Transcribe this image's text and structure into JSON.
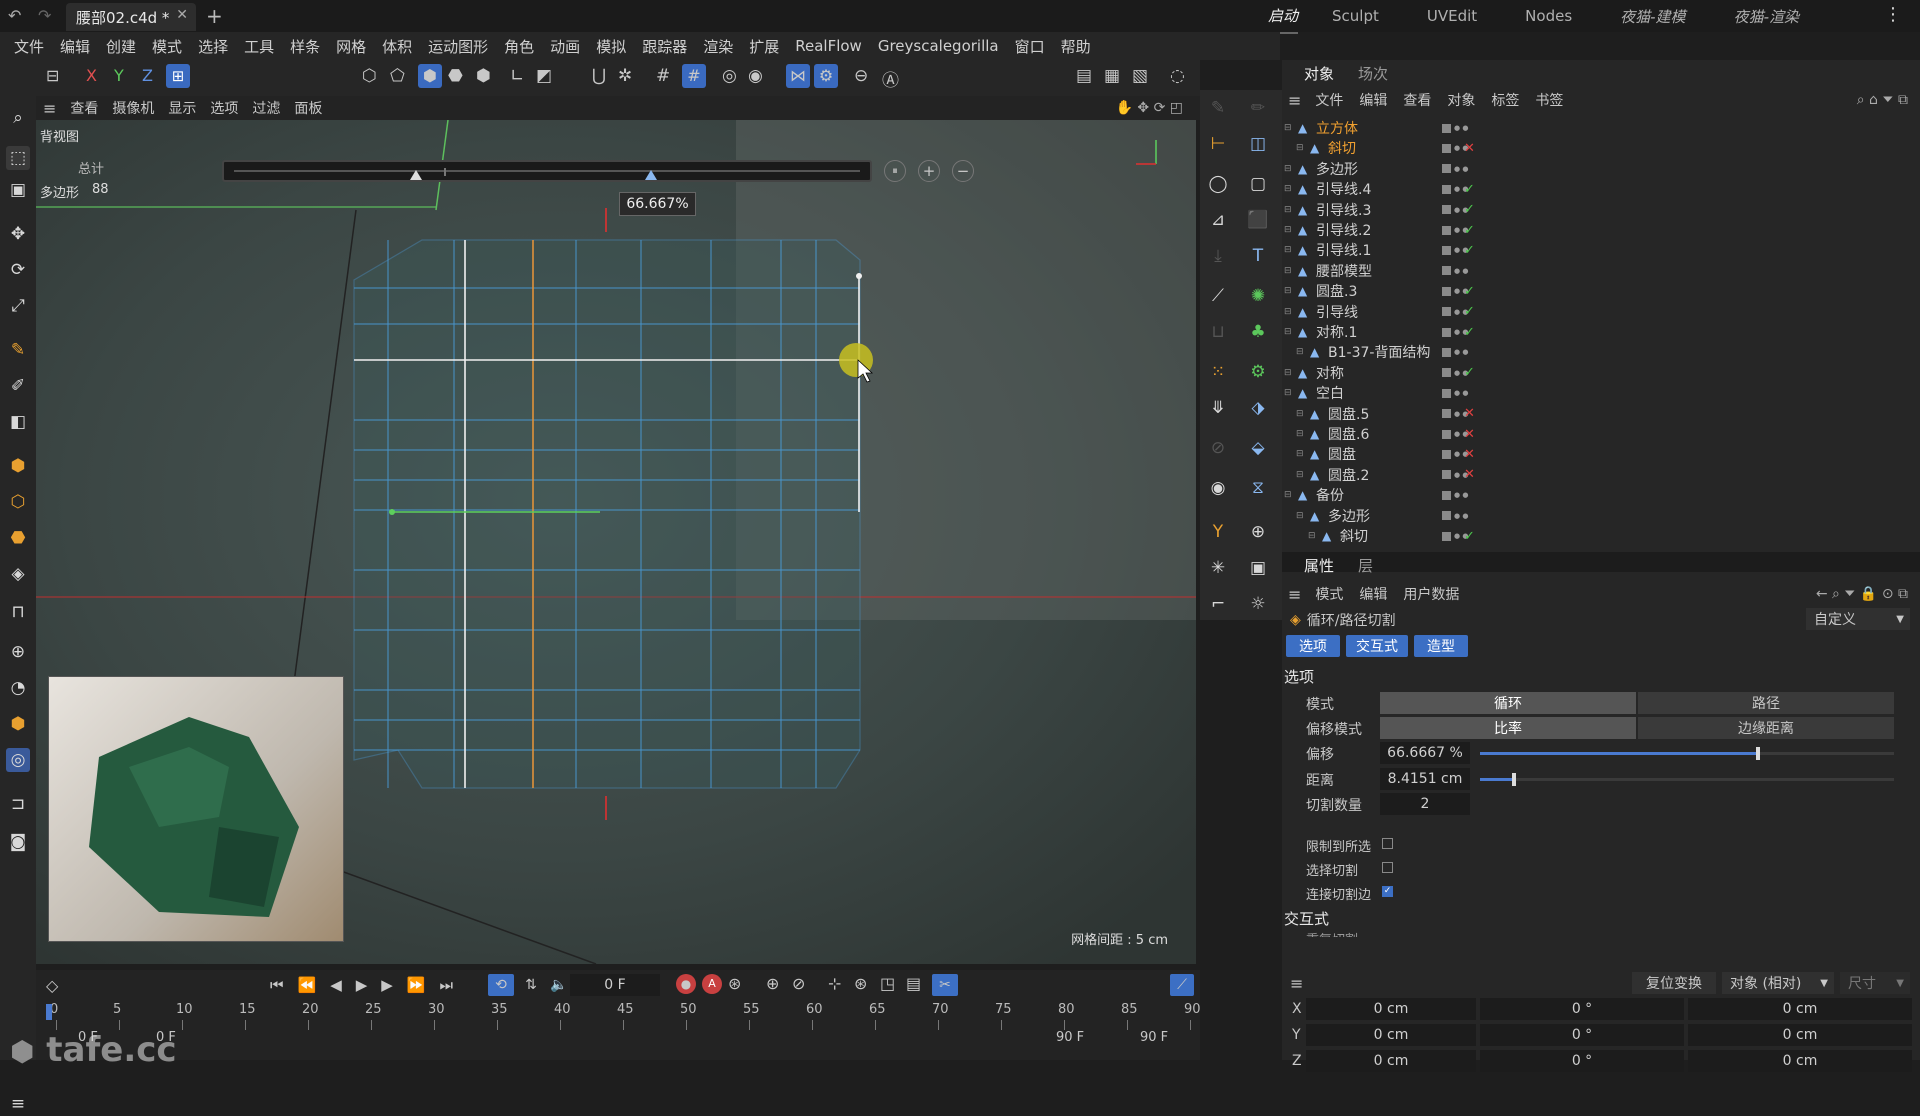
{
  "titlebar": {
    "tab_label": "腰部02.c4d *",
    "layouts": [
      "启动",
      "Sculpt",
      "UVEdit",
      "Nodes",
      "夜猫-建模",
      "夜猫-渲染"
    ]
  },
  "menubar": {
    "items": [
      "文件",
      "编辑",
      "创建",
      "模式",
      "选择",
      "工具",
      "样条",
      "网格",
      "体积",
      "运动图形",
      "角色",
      "动画",
      "模拟",
      "跟踪器",
      "渲染",
      "扩展",
      "RealFlow",
      "Greyscalegorilla",
      "窗口",
      "帮助"
    ]
  },
  "axis_lock": {
    "x": "X",
    "y": "Y",
    "z": "Z"
  },
  "viewport": {
    "menu": [
      "查看",
      "摄像机",
      "显示",
      "选项",
      "过滤",
      "面板"
    ],
    "background_label": "背视图",
    "stats_total": "总计",
    "stats_poly_label": "多边形",
    "stats_poly_value": "88",
    "slider_tooltip": "66.667%",
    "slider_value": 0.66667,
    "grid_spacing": "网格间距 : 5 cm"
  },
  "object_manager": {
    "tabs": [
      "对象",
      "场次"
    ],
    "menu": [
      "文件",
      "编辑",
      "查看",
      "对象",
      "标签",
      "书签"
    ],
    "rows": [
      {
        "name": "立方体",
        "indent": 0,
        "state": "none",
        "highlight": true
      },
      {
        "name": "斜切",
        "indent": 1,
        "state": "x",
        "highlight": true
      },
      {
        "name": "多边形",
        "indent": 0,
        "state": "none"
      },
      {
        "name": "引导线.4",
        "indent": 0,
        "state": "check"
      },
      {
        "name": "引导线.3",
        "indent": 0,
        "state": "check"
      },
      {
        "name": "引导线.2",
        "indent": 0,
        "state": "check"
      },
      {
        "name": "引导线.1",
        "indent": 0,
        "state": "check"
      },
      {
        "name": "腰部模型",
        "indent": 0,
        "state": "none"
      },
      {
        "name": "圆盘.3",
        "indent": 0,
        "state": "check"
      },
      {
        "name": "引导线",
        "indent": 0,
        "state": "check"
      },
      {
        "name": "对称.1",
        "indent": 0,
        "state": "check"
      },
      {
        "name": "B1-37-背面结构",
        "indent": 1,
        "state": "none"
      },
      {
        "name": "对称",
        "indent": 0,
        "state": "check"
      },
      {
        "name": "空白",
        "indent": 0,
        "state": "none"
      },
      {
        "name": "圆盘.5",
        "indent": 1,
        "state": "x"
      },
      {
        "name": "圆盘.6",
        "indent": 1,
        "state": "x"
      },
      {
        "name": "圆盘",
        "indent": 1,
        "state": "x"
      },
      {
        "name": "圆盘.2",
        "indent": 1,
        "state": "x"
      },
      {
        "name": "备份",
        "indent": 0,
        "state": "none"
      },
      {
        "name": "多边形",
        "indent": 1,
        "state": "none"
      },
      {
        "name": "斜切",
        "indent": 2,
        "state": "check"
      }
    ]
  },
  "attributes": {
    "tabs": [
      "属性",
      "层"
    ],
    "menu": [
      "模式",
      "编辑",
      "用户数据"
    ],
    "tool_name": "循环/路径切割",
    "preset": "自定义",
    "subtabs": [
      "选项",
      "交互式",
      "造型"
    ],
    "section_options": "选项",
    "mode_label": "模式",
    "mode_options": [
      "循环",
      "路径"
    ],
    "offset_mode_label": "偏移模式",
    "offset_mode_options": [
      "比率",
      "边缘距离"
    ],
    "offset_label": "偏移",
    "offset_value": "66.6667 %",
    "offset_fraction": 0.666667,
    "distance_label": "距离",
    "distance_value": "8.4151 cm",
    "cuts_label": "切割数量",
    "cuts_value": "2",
    "limit_label": "限制到所选",
    "select_cut_label": "选择切割",
    "connect_label": "连接切割边",
    "section_interactive": "交互式",
    "truncated_label": "重复切割"
  },
  "coordinates": {
    "reset_label": "复位变换",
    "mode_label": "对象 (相对)",
    "size_label": "尺寸",
    "rows": [
      {
        "axis": "X",
        "p": "0 cm",
        "r": "0 °",
        "s": "0 cm"
      },
      {
        "axis": "Y",
        "p": "0 cm",
        "r": "0 °",
        "s": "0 cm"
      },
      {
        "axis": "Z",
        "p": "0 cm",
        "r": "0 °",
        "s": "0 cm"
      }
    ]
  },
  "timeline": {
    "current_frame": "0 F",
    "ticks": [
      "0",
      "5",
      "10",
      "15",
      "20",
      "25",
      "30",
      "35",
      "40",
      "45",
      "50",
      "55",
      "60",
      "65",
      "70",
      "75",
      "80",
      "85",
      "90"
    ],
    "start_a": "0 F",
    "start_b": "0 F",
    "end_a": "90 F",
    "end_b": "90 F"
  },
  "watermark": "tafe.cc"
}
